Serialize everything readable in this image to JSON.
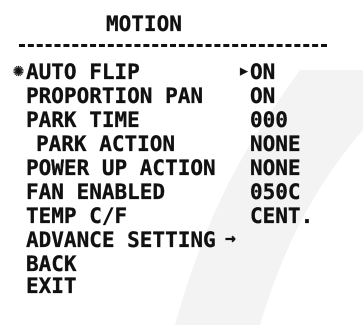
{
  "menu": {
    "title": "MOTION",
    "divider": "-------------------------------",
    "cursor_icon": "sun-cursor-icon",
    "selected_marker_icon": "triangle-right-icon",
    "items": [
      {
        "label": "AUTO FLIP",
        "value": "ON",
        "selected": true
      },
      {
        "label": "PROPORTION PAN",
        "value": "ON"
      },
      {
        "label": "PARK TIME",
        "value": "000"
      },
      {
        "label": "PARK ACTION",
        "value": "NONE",
        "indented": true
      },
      {
        "label": "POWER UP ACTION",
        "value": "NONE"
      },
      {
        "label": "FAN ENABLED",
        "value": "050C"
      },
      {
        "label": "TEMP C/F",
        "value": "CENT."
      },
      {
        "label": "ADVANCE SETTING",
        "value": "→"
      },
      {
        "label": "BACK"
      },
      {
        "label": "EXIT"
      }
    ]
  }
}
